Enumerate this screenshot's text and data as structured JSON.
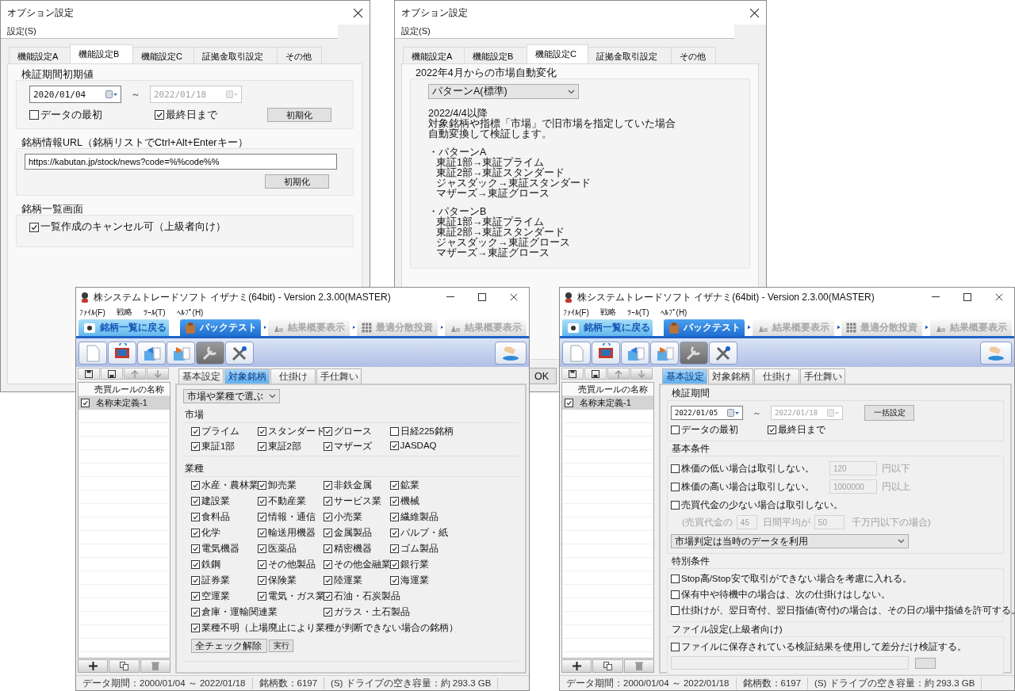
{
  "option_dialogs": [
    {
      "title": "オプション設定",
      "menu": [
        "設定(S)"
      ],
      "tabs": [
        {
          "label": "機能設定A",
          "selected": false
        },
        {
          "label": "機能設定B",
          "selected": true
        },
        {
          "label": "機能設定C",
          "selected": false
        },
        {
          "label": "証拠金取引設定",
          "selected": false
        },
        {
          "label": "その他",
          "selected": false
        }
      ],
      "panel": {
        "kind": "defaults",
        "period": {
          "title": "検証期間初期値",
          "start": {
            "value": "2020/01/04",
            "disabled": false
          },
          "separator": "～",
          "end": {
            "value": "2022/01/18",
            "disabled": true
          },
          "checks": [
            {
              "label": "データの最初",
              "checked": false
            },
            {
              "label": "最終日まで",
              "checked": true
            }
          ],
          "button": "初期化"
        },
        "url": {
          "title": "銘柄情報URL（銘柄リストでCtrl+Alt+Enterキー）",
          "value": "https://kabutan.jp/stock/news?code=%%code%%",
          "button": "初期化"
        },
        "list_screen": {
          "title": "銘柄一覧画面",
          "check": {
            "label": "一覧作成のキャンセル可（上級者向け）",
            "checked": true
          }
        }
      }
    },
    {
      "title": "オプション設定",
      "menu": [
        "設定(S)"
      ],
      "tabs": [
        {
          "label": "機能設定A",
          "selected": false
        },
        {
          "label": "機能設定B",
          "selected": false
        },
        {
          "label": "機能設定C",
          "selected": true
        },
        {
          "label": "証拠金取引設定",
          "selected": false
        },
        {
          "label": "その他",
          "selected": false
        }
      ],
      "panel": {
        "kind": "market_change",
        "title": "2022年4月からの市場自動変化",
        "select": "パターンA(標準)",
        "blocks": [
          {
            "kind": "note",
            "heading": "2022/4/4以降",
            "lines": [
              "対象銘柄や指標「市場」で旧市場を指定していた場合",
              "自動変換して検証します。"
            ]
          },
          {
            "kind": "pattern",
            "heading": "・パターンA",
            "lines": [
              "東証1部→東証プライム",
              "東証2部→東証スタンダード",
              "ジャスダック→東証スタンダード",
              "マザーズ→東証グロース"
            ]
          },
          {
            "kind": "pattern",
            "heading": "・パターンB",
            "lines": [
              "東証1部→東証プライム",
              "東証2部→東証スタンダード",
              "ジャスダック→東証グロース",
              "マザーズ→東証グロース"
            ]
          }
        ]
      },
      "buttons": [
        "OK"
      ]
    }
  ],
  "app_windows": [
    {
      "title": "株システムトレードソフト イザナミ(64bit) - Version 2.3.00(MASTER)",
      "menu": [
        "ﾌｧｲﾙ(F)",
        "戦略",
        "ﾂｰﾙ(T)",
        "ﾍﾙﾌﾟ(H)"
      ],
      "nav": [
        {
          "label": "銘柄一覧に戻る",
          "kind": "back",
          "selected": false
        },
        {
          "label": "バックテスト",
          "kind": "step",
          "selected": true
        },
        {
          "label": "結果概要表示",
          "kind": "next",
          "selected": false
        },
        {
          "label": "最適分散投資",
          "kind": "next",
          "selected": false
        },
        {
          "label": "結果概要表示",
          "kind": "next",
          "selected": false
        }
      ],
      "toolbar": [
        {
          "pressed": false
        },
        {
          "pressed": false
        },
        {
          "pressed": false
        },
        {
          "pressed": false
        },
        {
          "pressed": true
        },
        {
          "pressed": false
        }
      ],
      "rules": {
        "header": "売買ルールの名称",
        "items": [
          {
            "label": "名称未定義-1",
            "checked": true,
            "selected": true
          }
        ]
      },
      "tabs": [
        {
          "label": "基本設定",
          "selected": false
        },
        {
          "label": "対象銘柄",
          "selected": true
        },
        {
          "label": "仕掛け",
          "selected": false
        },
        {
          "label": "手仕舞い",
          "selected": false
        }
      ],
      "panel": {
        "kind": "targets",
        "selector": "市場や業種で選ぶ",
        "sections": [
          {
            "title": "市場",
            "rows": [
              [
                {
                  "label": "プライム",
                  "checked": true
                },
                {
                  "label": "スタンダード",
                  "checked": true
                },
                {
                  "label": "グロース",
                  "checked": true
                },
                {
                  "label": "日経225銘柄",
                  "checked": false
                }
              ],
              [
                {
                  "label": "東証1部",
                  "checked": true
                },
                {
                  "label": "東証2部",
                  "checked": true
                },
                {
                  "label": "マザーズ",
                  "checked": true
                },
                {
                  "label": "JASDAQ",
                  "checked": true
                }
              ]
            ]
          },
          {
            "title": "業種",
            "rows": [
              [
                {
                  "label": "水産・農林業",
                  "checked": true
                },
                {
                  "label": "卸売業",
                  "checked": true
                },
                {
                  "label": "非鉄金属",
                  "checked": true
                },
                {
                  "label": "鉱業",
                  "checked": true
                }
              ],
              [
                {
                  "label": "建設業",
                  "checked": true
                },
                {
                  "label": "不動産業",
                  "checked": true
                },
                {
                  "label": "サービス業",
                  "checked": true
                },
                {
                  "label": "機械",
                  "checked": true
                }
              ],
              [
                {
                  "label": "食料品",
                  "checked": true
                },
                {
                  "label": "情報・通信",
                  "checked": true
                },
                {
                  "label": "小売業",
                  "checked": true
                },
                {
                  "label": "繊維製品",
                  "checked": true
                }
              ],
              [
                {
                  "label": "化学",
                  "checked": true
                },
                {
                  "label": "輸送用機器",
                  "checked": true
                },
                {
                  "label": "金属製品",
                  "checked": true
                },
                {
                  "label": "パルプ・紙",
                  "checked": true
                }
              ],
              [
                {
                  "label": "電気機器",
                  "checked": true
                },
                {
                  "label": "医薬品",
                  "checked": true
                },
                {
                  "label": "精密機器",
                  "checked": true
                },
                {
                  "label": "ゴム製品",
                  "checked": true
                }
              ],
              [
                {
                  "label": "鉄鋼",
                  "checked": true
                },
                {
                  "label": "その他製品",
                  "checked": true
                },
                {
                  "label": "その他金融業",
                  "checked": true
                },
                {
                  "label": "銀行業",
                  "checked": true
                }
              ],
              [
                {
                  "label": "証券業",
                  "checked": true
                },
                {
                  "label": "保険業",
                  "checked": true
                },
                {
                  "label": "陸運業",
                  "checked": true
                },
                {
                  "label": "海運業",
                  "checked": true
                }
              ],
              [
                {
                  "label": "空運業",
                  "checked": true
                },
                {
                  "label": "電気・ガス業",
                  "checked": true
                },
                {
                  "label": "石油・石炭製品",
                  "checked": true
                }
              ],
              [
                {
                  "label": "倉庫・運輸関連業",
                  "checked": true
                },
                null,
                {
                  "label": "ガラス・土石製品",
                  "checked": true
                }
              ]
            ]
          }
        ],
        "unknown": {
          "label": "業種不明（上場廃止により業種が判断できない場合の銘柄）",
          "checked": true
        },
        "action_select": "全チェック解除",
        "action_button": "実行"
      },
      "status": [
        "データ期間：2000/01/04 ～ 2022/01/18",
        "銘柄数：6197",
        "(S) ドライブの空き容量：約 293.3 GB"
      ]
    },
    {
      "title": "株システムトレードソフト イザナミ(64bit) - Version 2.3.00(MASTER)",
      "menu": [
        "ﾌｧｲﾙ(F)",
        "戦略",
        "ﾂｰﾙ(T)",
        "ﾍﾙﾌﾟ(H)"
      ],
      "nav": [
        {
          "label": "銘柄一覧に戻る",
          "kind": "back",
          "selected": false
        },
        {
          "label": "バックテスト",
          "kind": "step",
          "selected": true
        },
        {
          "label": "結果概要表示",
          "kind": "next",
          "selected": false
        },
        {
          "label": "最適分散投資",
          "kind": "next",
          "selected": false
        },
        {
          "label": "結果概要表示",
          "kind": "next",
          "selected": false
        }
      ],
      "toolbar": [
        {
          "pressed": false
        },
        {
          "pressed": false
        },
        {
          "pressed": false
        },
        {
          "pressed": false
        },
        {
          "pressed": true
        },
        {
          "pressed": false
        }
      ],
      "rules": {
        "header": "売買ルールの名称",
        "items": [
          {
            "label": "名称未定義-1",
            "checked": true,
            "selected": true
          }
        ]
      },
      "tabs": [
        {
          "label": "基本設定",
          "selected": true
        },
        {
          "label": "対象銘柄",
          "selected": false
        },
        {
          "label": "仕掛け",
          "selected": false
        },
        {
          "label": "手仕舞い",
          "selected": false
        }
      ],
      "panel": {
        "kind": "basic",
        "period": {
          "title": "検証期間",
          "start": {
            "value": "2022/01/05",
            "disabled": false
          },
          "separator": "～",
          "end": {
            "value": "2022/01/18",
            "disabled": true
          },
          "button": "一括設定",
          "checks": [
            {
              "label": "データの最初",
              "checked": false
            },
            {
              "label": "最終日まで",
              "checked": true
            }
          ]
        },
        "conditions": {
          "title": "基本条件",
          "rules": [
            {
              "label": "株価の低い場合は取引しない。",
              "checked": false,
              "value": "120",
              "unit": "円以下"
            },
            {
              "label": "株価の高い場合は取引しない。",
              "checked": false,
              "value": "1000000",
              "unit": "円以上"
            },
            {
              "label": "売買代金の少ない場合は取引しない。",
              "checked": false
            }
          ],
          "average": {
            "prefix": "(売買代金の",
            "days": "45",
            "middle": "日間平均が",
            "amount": "50",
            "suffix": "千万円以下の場合)"
          },
          "market_select": "市場判定は当時のデータを利用"
        },
        "special": {
          "title": "特別条件",
          "checks": [
            {
              "label": "Stop高/Stop安で取引ができない場合を考慮に入れる。",
              "checked": false
            },
            {
              "label": "保有中や待機中の場合は、次の仕掛けはしない。",
              "checked": false
            },
            {
              "label": "仕掛けが、翌日寄付、翌日指値(寄付)の場合は、その日の場中指値を許可する。",
              "checked": false
            }
          ]
        },
        "file": {
          "title": "ファイル設定(上級者向け)",
          "check": {
            "label": "ファイルに保存されている検証結果を使用して差分だけ検証する。",
            "checked": false
          }
        }
      },
      "status": [
        "データ期間：2000/01/04 ～ 2022/01/18",
        "銘柄数：6197",
        "(S) ドライブの空き容量：約 293.3 GB"
      ]
    }
  ]
}
